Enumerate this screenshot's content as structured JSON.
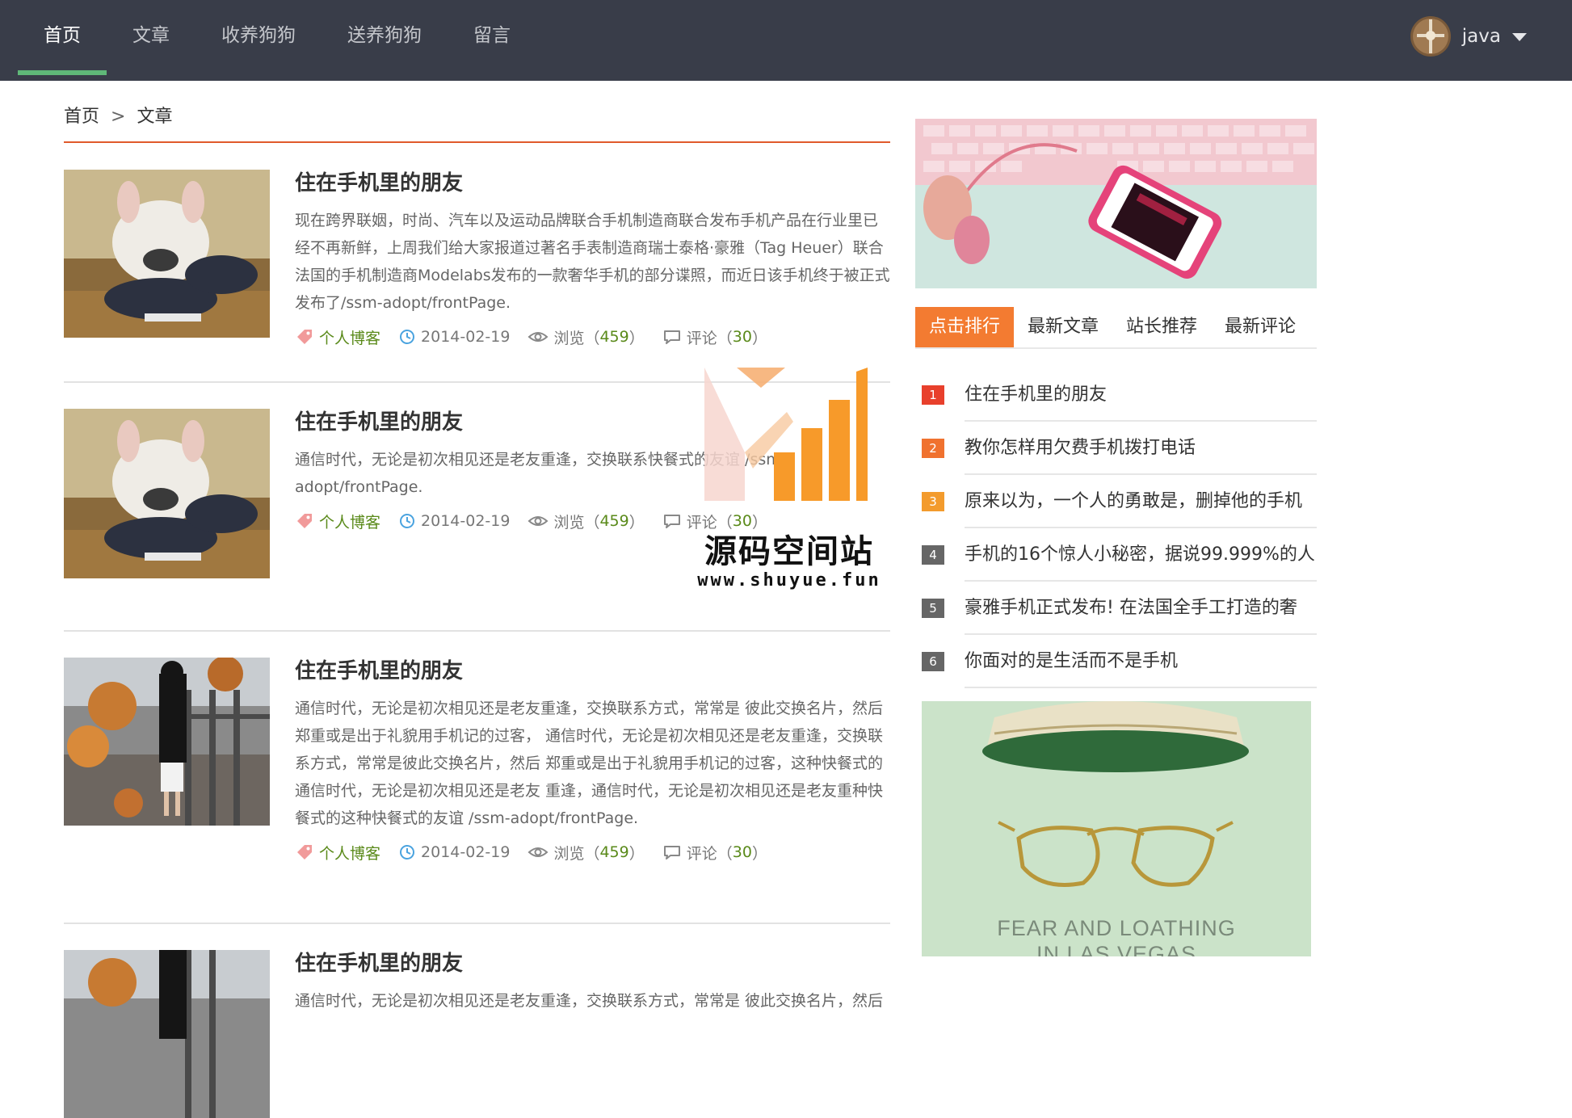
{
  "nav": {
    "items": [
      {
        "label": "首页",
        "active": true
      },
      {
        "label": "文章"
      },
      {
        "label": "收养狗狗"
      },
      {
        "label": "送养狗狗"
      },
      {
        "label": "留言"
      }
    ],
    "user": {
      "name": "java"
    }
  },
  "breadcrumb": {
    "home": "首页",
    "separator": ">",
    "current": "文章"
  },
  "articles": [
    {
      "title": "住在手机里的朋友",
      "excerpt": "现在跨界联姻，时尚、汽车以及运动品牌联合手机制造商联合发布手机产品在行业里已经不再新鲜，上周我们给大家报道过著名手表制造商瑞士泰格·豪雅（Tag Heuer）联合法国的手机制造商Modelabs发布的一款奢华手机的部分谍照，而近日该手机终于被正式发布了/ssm-adopt/frontPage.",
      "tag": "个人博客",
      "date": "2014-02-19",
      "views_label": "浏览（",
      "views": "459",
      "views_close": "）",
      "comments_label": "评论（",
      "comments": "30",
      "comments_close": "）"
    },
    {
      "title": "住在手机里的朋友",
      "excerpt": "通信时代，无论是初次相见还是老友重逢，交换联系快餐式的友谊 /ssm-adopt/frontPage.",
      "tag": "个人博客",
      "date": "2014-02-19",
      "views_label": "浏览（",
      "views": "459",
      "views_close": "）",
      "comments_label": "评论（",
      "comments": "30",
      "comments_close": "）"
    },
    {
      "title": "住在手机里的朋友",
      "excerpt": "通信时代，无论是初次相见还是老友重逢，交换联系方式，常常是 彼此交换名片，然后郑重或是出于礼貌用手机记的过客， 通信时代，无论是初次相见还是老友重逢，交换联系方式，常常是彼此交换名片，然后 郑重或是出于礼貌用手机记的过客，这种快餐式的通信时代，无论是初次相见还是老友 重逢，通信时代，无论是初次相见还是老友重种快餐式的这种快餐式的友谊 /ssm-adopt/frontPage.",
      "tag": "个人博客",
      "date": "2014-02-19",
      "views_label": "浏览（",
      "views": "459",
      "views_close": "）",
      "comments_label": "评论（",
      "comments": "30",
      "comments_close": "）"
    },
    {
      "title": "住在手机里的朋友",
      "excerpt": "通信时代，无论是初次相见还是老友重逢，交换联系方式，常常是 彼此交换名片，然后"
    }
  ],
  "sidebar": {
    "tabs": [
      "点击排行",
      "最新文章",
      "站长推荐",
      "最新评论"
    ],
    "ranking": [
      {
        "num": "1",
        "text": "住在手机里的朋友",
        "color": "#e8402c"
      },
      {
        "num": "2",
        "text": "教你怎样用欠费手机拨打电话",
        "color": "#f0722f"
      },
      {
        "num": "3",
        "text": "原来以为，一个人的勇敢是，删掉他的手机",
        "color": "#f39b2d"
      },
      {
        "num": "4",
        "text": "手机的16个惊人小秘密，据说99.999%的人",
        "color": "#666666"
      },
      {
        "num": "5",
        "text": "豪雅手机正式发布! 在法国全手工打造的奢",
        "color": "#666666"
      },
      {
        "num": "6",
        "text": "你面对的是生活而不是手机",
        "color": "#666666"
      }
    ],
    "poster_text": "FEAR AND LOATHING IN LAS VEGAS"
  },
  "watermark": {
    "name": "源码空间站",
    "url": "www.shuyue.fun"
  },
  "colors": {
    "nav_bg": "#393d49",
    "nav_active": "#5fb878",
    "accent": "#f37b31",
    "link_green": "#5a8a1a"
  }
}
